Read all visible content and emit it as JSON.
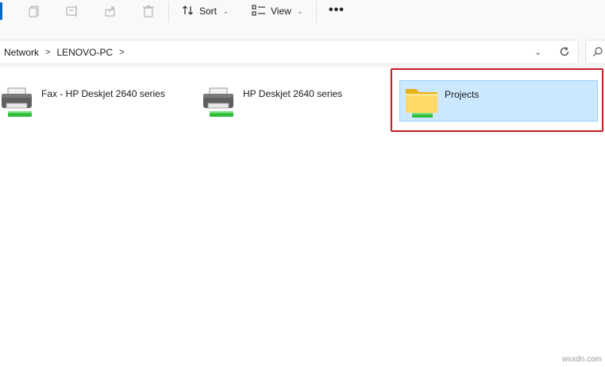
{
  "toolbar": {
    "sort_label": "Sort",
    "view_label": "View",
    "more_label": "•••",
    "icons": [
      "copy-icon",
      "rename-icon",
      "share-icon",
      "delete-icon",
      "sort-icon",
      "view-icon"
    ]
  },
  "address": {
    "crumbs": [
      "Network",
      "LENOVO-PC"
    ],
    "separator": ">"
  },
  "items": [
    {
      "label": "Fax - HP Deskjet 2640 series",
      "icon": "printer-icon"
    },
    {
      "label": "HP Deskjet 2640 series",
      "icon": "printer-icon"
    },
    {
      "label": "Projects",
      "icon": "shared-folder-icon",
      "selected": true
    }
  ],
  "colors": {
    "selection_bg": "#cce8ff",
    "selection_border": "#99d1ff",
    "highlight": "#c0272d",
    "accent": "#0a67c2"
  },
  "watermark": "wsxdn.com"
}
